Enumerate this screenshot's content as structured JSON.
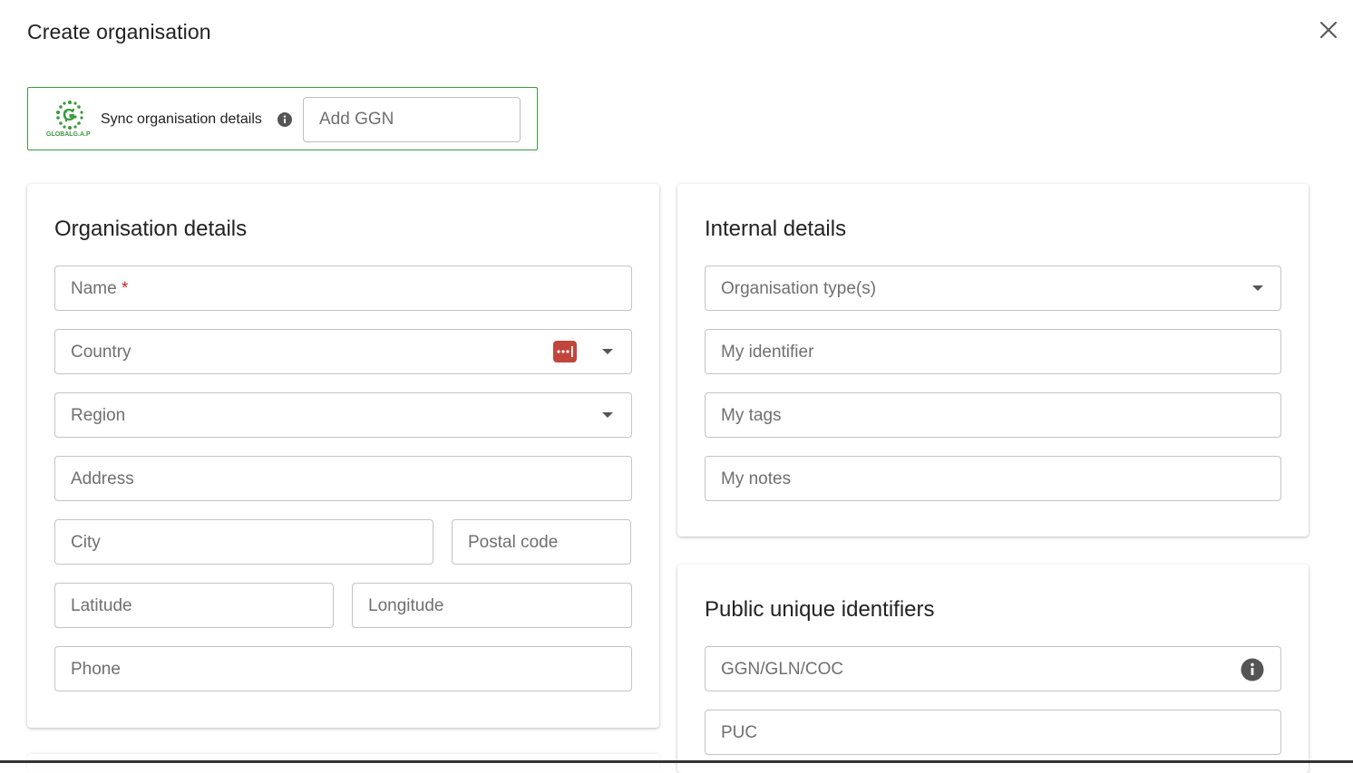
{
  "dialog": {
    "title": "Create organisation"
  },
  "sync": {
    "brand": "GLOBALG.A.P",
    "label": "Sync organisation details",
    "ggn_placeholder": "Add GGN"
  },
  "organisation_details": {
    "title": "Organisation details",
    "fields": {
      "name": "Name",
      "required_mark": "*",
      "country": "Country",
      "region": "Region",
      "address": "Address",
      "city": "City",
      "postal_code": "Postal code",
      "latitude": "Latitude",
      "longitude": "Longitude",
      "phone": "Phone"
    }
  },
  "internal_details": {
    "title": "Internal details",
    "fields": {
      "organisation_types": "Organisation type(s)",
      "my_identifier": "My identifier",
      "my_tags": "My tags",
      "my_notes": "My notes"
    }
  },
  "public_identifiers": {
    "title": "Public unique identifiers",
    "fields": {
      "ggn": "GGN/GLN/COC",
      "puc": "PUC"
    }
  },
  "icons": {
    "close": "close-icon",
    "info": "info-icon",
    "dropdown": "chevron-down-icon",
    "password_manager": "password-manager-icon",
    "logo": "globalgap-logo"
  },
  "colors": {
    "accent_green": "#3a9a3c",
    "required_red": "#c62828",
    "password_icon_red": "#c2453b",
    "field_border": "#c4c4c4",
    "label_grey": "#6f6f6f"
  }
}
